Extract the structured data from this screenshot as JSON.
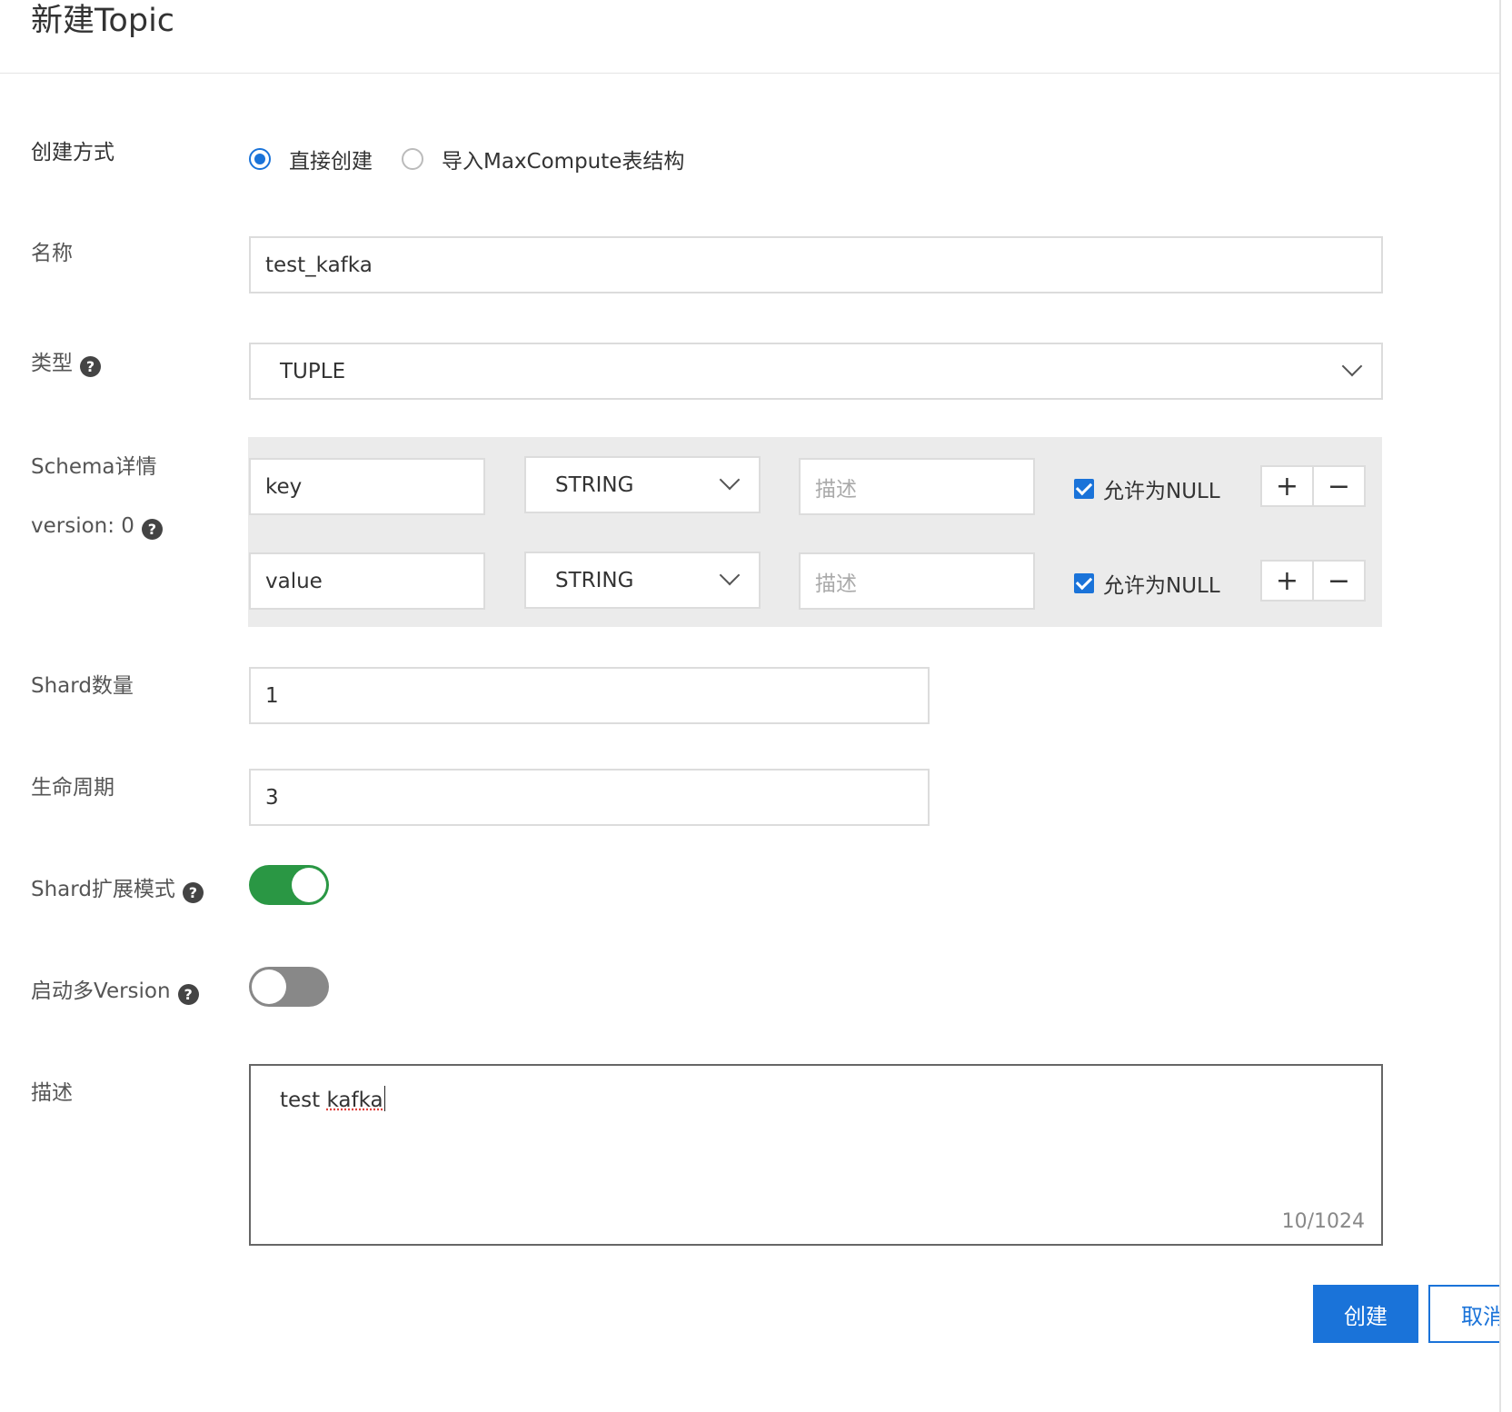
{
  "dialog": {
    "title": "新建Topic"
  },
  "form": {
    "create_method": {
      "label": "创建方式",
      "options": [
        {
          "label": "直接创建",
          "selected": true
        },
        {
          "label": "导入MaxCompute表结构",
          "selected": false
        }
      ]
    },
    "name": {
      "label": "名称",
      "value": "test_kafka"
    },
    "type": {
      "label": "类型",
      "help": "?",
      "value": "TUPLE"
    },
    "schema": {
      "label": "Schema详情",
      "version_label": "version: 0",
      "help": "?",
      "rows": [
        {
          "field": "key",
          "type": "STRING",
          "desc_placeholder": "描述",
          "allow_null_label": "允许为NULL",
          "allow_null": true,
          "add": "+",
          "remove": "−"
        },
        {
          "field": "value",
          "type": "STRING",
          "desc_placeholder": "描述",
          "allow_null_label": "允许为NULL",
          "allow_null": true,
          "add": "+",
          "remove": "−"
        }
      ]
    },
    "shard_count": {
      "label": "Shard数量",
      "value": "1"
    },
    "lifecycle": {
      "label": "生命周期",
      "value": "3"
    },
    "shard_extend": {
      "label": "Shard扩展模式",
      "help": "?",
      "enabled": true
    },
    "multi_version": {
      "label": "启动多Version",
      "help": "?",
      "enabled": false
    },
    "description": {
      "label": "描述",
      "value": "test kafka",
      "value_plain": "test ",
      "value_misspelled": "kafka",
      "counter": "10/1024"
    }
  },
  "actions": {
    "create": "创建",
    "cancel": "取消"
  },
  "colors": {
    "primary": "#1a73d9",
    "toggle_on": "#2a9744",
    "toggle_off": "#888888"
  }
}
